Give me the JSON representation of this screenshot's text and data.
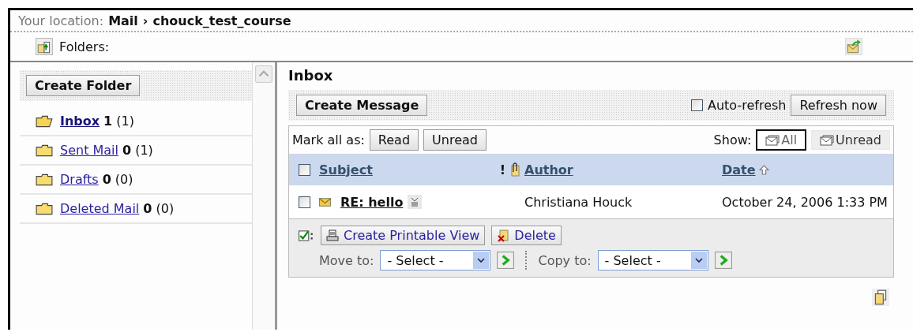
{
  "location": {
    "label": "Your location:",
    "crumbs": [
      "Mail",
      "›",
      "chouck_test_course"
    ]
  },
  "folders_label": "Folders:",
  "sidebar": {
    "create_button": "Create Folder",
    "items": [
      {
        "name": "Inbox ",
        "unread": "1",
        "total": "(1)",
        "selected": true
      },
      {
        "name": "Sent Mail ",
        "unread": "0",
        "total": "(1)",
        "selected": false
      },
      {
        "name": "Drafts ",
        "unread": "0",
        "total": "(0)",
        "selected": false
      },
      {
        "name": "Deleted Mail ",
        "unread": "0",
        "total": "(0)",
        "selected": false
      }
    ]
  },
  "main": {
    "title": "Inbox",
    "create_button": "Create Message",
    "auto_refresh": {
      "label": "Auto-refresh",
      "checked": false
    },
    "refresh_button": "Refresh now",
    "mark_all": {
      "label": "Mark all as:",
      "buttons": [
        "Read",
        "Unread"
      ]
    },
    "show": {
      "label": "Show:",
      "options": [
        {
          "label": "All",
          "selected": true
        },
        {
          "label": "Unread",
          "selected": false
        }
      ]
    },
    "table": {
      "select_all": false,
      "columns": [
        "Subject",
        "!",
        "Author",
        "Date "
      ],
      "rows": [
        {
          "checked": false,
          "unread": true,
          "subject": "RE: hello",
          "author": "Christiana Houck",
          "date": "October 24, 2006 1:33 PM"
        }
      ]
    },
    "actions": {
      "print_button": "Create Printable View",
      "delete_button": "Delete",
      "move": {
        "label": "Move to:",
        "value": "- Select -"
      },
      "copy": {
        "label": "Copy to:",
        "value": "- Select -"
      }
    }
  }
}
